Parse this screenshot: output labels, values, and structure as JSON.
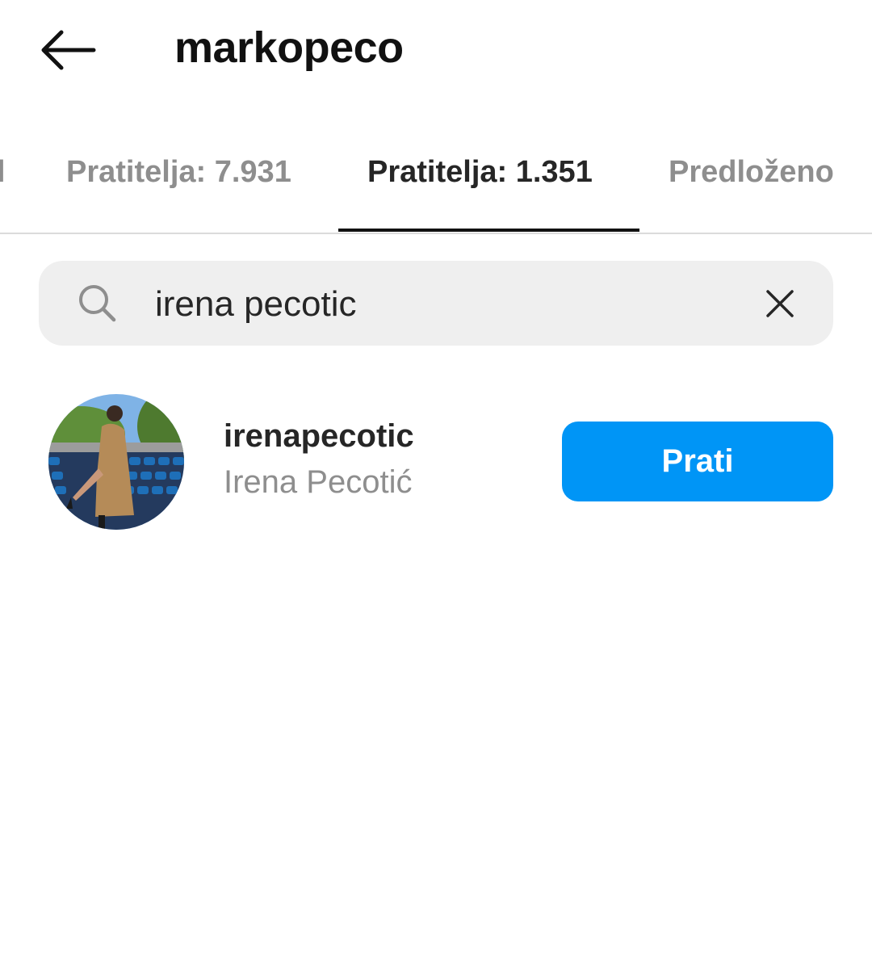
{
  "header": {
    "title": "markopeco",
    "back_icon": "arrow-left-icon"
  },
  "tabs": [
    {
      "label": "Pratitelja: 7.931",
      "active": false
    },
    {
      "label": "Pratitelja: 1.351",
      "active": true
    },
    {
      "label": "Predloženo",
      "active": false
    }
  ],
  "search": {
    "value": "irena pecotic",
    "icon": "search-icon",
    "clear_icon": "close-icon"
  },
  "results": [
    {
      "username": "irenapecotic",
      "full_name": "Irena Pecotić",
      "action_label": "Prati"
    }
  ],
  "colors": {
    "accent": "#0095f6",
    "search_bg": "#efefef",
    "muted_text": "#8e8e8e"
  }
}
